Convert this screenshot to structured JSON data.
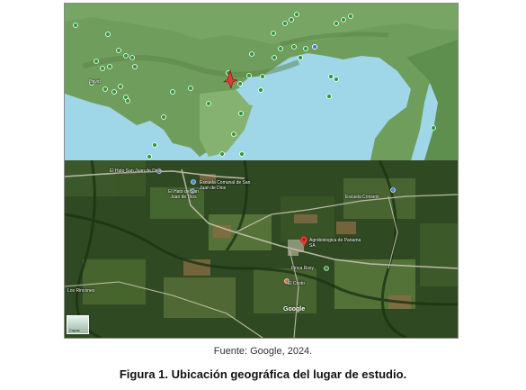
{
  "top_map": {
    "city_label": "David"
  },
  "satellite_map": {
    "labels": {
      "el_hato_road": "El Hato San Juan de Dios",
      "school": "Escuela Comunal de San Juan de Dios",
      "el_hato_town": "El Hato de San Juan de Dios",
      "farm": "Agrobiologica de Panama SA",
      "finca": "Finca Rosy",
      "escuela_right": "Escuela Consejo",
      "el_cristo": "El Cristo",
      "los_rincones": "Los Rincones"
    },
    "thumbnail_label": "Capas",
    "attribution": "Google"
  },
  "source_text": "Fuente: Google, 2024.",
  "caption_text": "Figura 1. Ubicación geográfica del lugar de estudio.",
  "colors": {
    "sea": "#9fd6e8",
    "land": "#6f9e5c",
    "marker_green": "#2e9a3c",
    "marker_red": "#e53935",
    "satellite_base": "#2f4a22"
  }
}
